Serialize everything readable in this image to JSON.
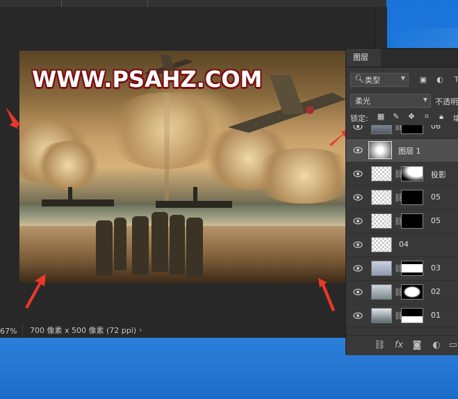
{
  "canvas": {
    "watermark": "WWW.PSAHZ.COM"
  },
  "status_bar": {
    "zoom": "67%",
    "document_size": "700 像素 x 500 像素 (72 ppi)",
    "more_arrow": "›"
  },
  "layers_panel": {
    "tab_label": "图层",
    "filter_type_label": "类型",
    "blend_mode": "柔光",
    "opacity_label": "不透明",
    "lock_label": "锁定:",
    "fill_label": "填",
    "layers": [
      {
        "name": "06",
        "has_mask": true,
        "selected": false
      },
      {
        "name": "图层 1",
        "has_mask": false,
        "selected": true
      },
      {
        "name": "投影",
        "has_mask": true,
        "selected": false
      },
      {
        "name": "05",
        "has_mask": true,
        "selected": false
      },
      {
        "name": "05",
        "has_mask": true,
        "selected": false
      },
      {
        "name": "04",
        "has_mask": false,
        "selected": false
      },
      {
        "name": "03",
        "has_mask": true,
        "selected": false
      },
      {
        "name": "02",
        "has_mask": true,
        "selected": false
      },
      {
        "name": "01",
        "has_mask": true,
        "selected": false
      }
    ],
    "footer_icons": [
      "link-layers-icon",
      "fx-icon",
      "add-mask-icon",
      "adjustment-layer-icon",
      "new-group-icon"
    ],
    "fx_label": "fx"
  },
  "colors": {
    "annotation_arrow": "#e8372c",
    "watermark_stroke": "#7a1010",
    "panel_bg": "#383838",
    "selected_layer_bg": "#4f4f4f"
  }
}
